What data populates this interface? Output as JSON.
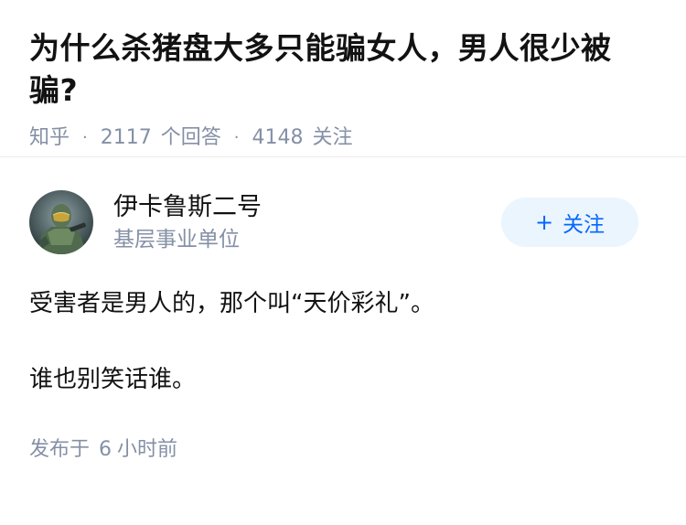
{
  "question": {
    "title": "为什么杀猪盘大多只能骗女人，男人很少被骗?",
    "source": "知乎",
    "answer_count": "2117",
    "answer_label": "个回答",
    "follow_count": "4148",
    "follow_label": "关注",
    "separator": "·"
  },
  "answer": {
    "author": {
      "name": "伊卡鲁斯二号",
      "description": "基层事业单位",
      "avatar_icon": "armored-soldier-avatar"
    },
    "follow_button": {
      "plus": "+",
      "label": "关注"
    },
    "paragraphs": [
      "受害者是男人的，那个叫“天价彩礼”。",
      "谁也别笑话谁。"
    ],
    "publish": {
      "prefix": "发布于",
      "number": "6",
      "suffix": "小时前"
    }
  },
  "colors": {
    "text_primary": "#121212",
    "text_secondary": "#8590a6",
    "accent": "#0566ff",
    "follow_bg": "#ebf5fd"
  }
}
